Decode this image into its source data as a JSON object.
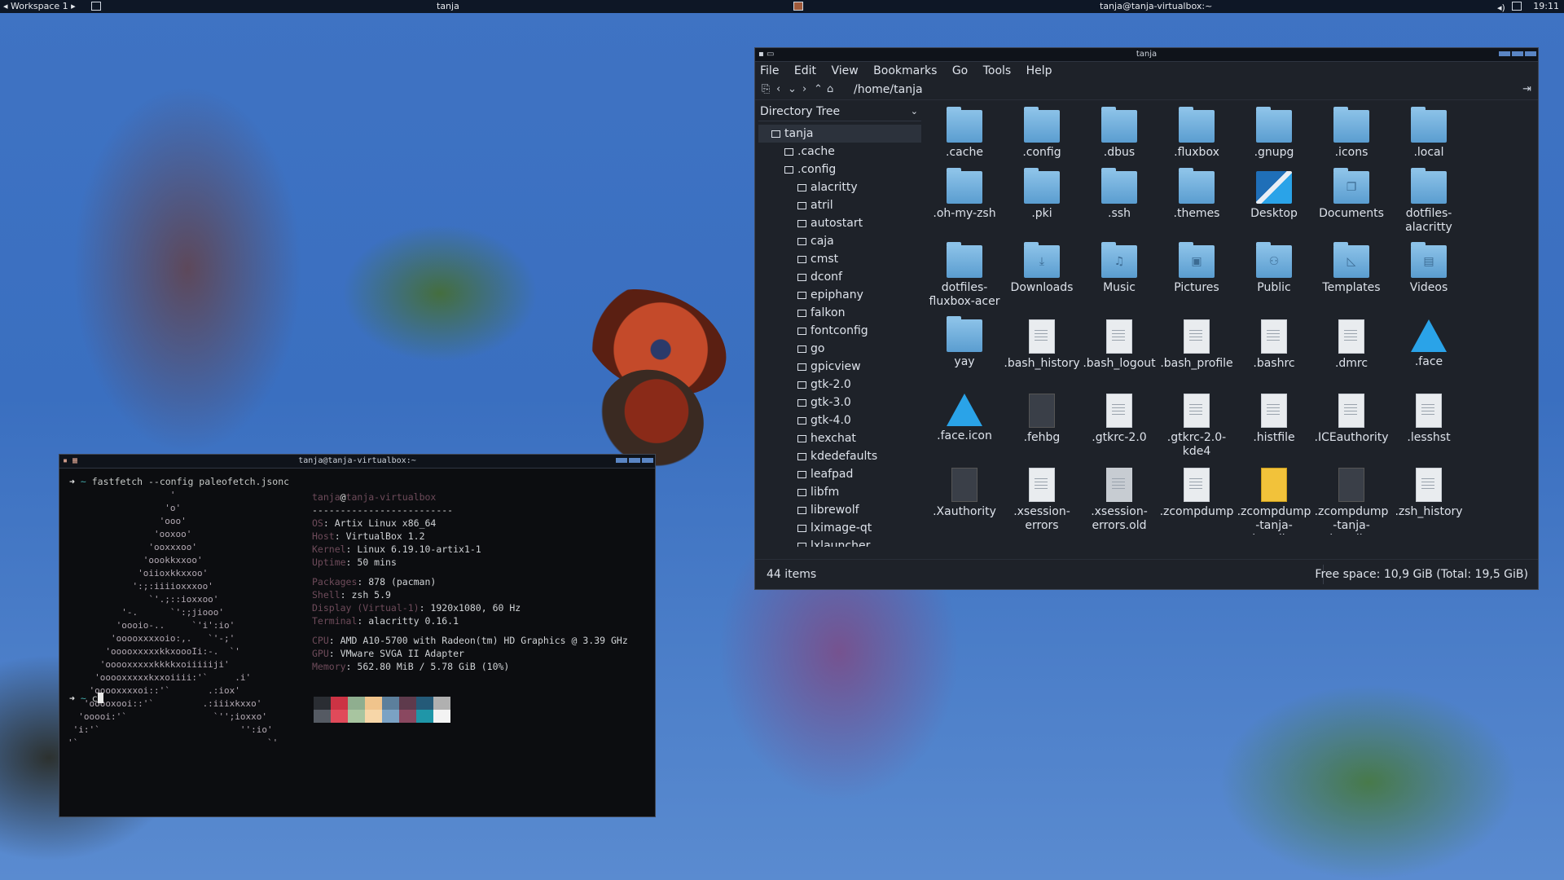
{
  "panel": {
    "workspace": "Workspace 1",
    "active_title": "tanja",
    "hostname": "tanja@tanja-virtualbox:~",
    "clock": "19:11"
  },
  "file_manager": {
    "title": "tanja",
    "menu": [
      "File",
      "Edit",
      "View",
      "Bookmarks",
      "Go",
      "Tools",
      "Help"
    ],
    "path": "/home/tanja",
    "sidebar_header": "Directory Tree",
    "tree": [
      {
        "label": "tanja",
        "level": 0,
        "selected": true
      },
      {
        "label": ".cache",
        "level": 1
      },
      {
        "label": ".config",
        "level": 1
      },
      {
        "label": "alacritty",
        "level": 2
      },
      {
        "label": "atril",
        "level": 2
      },
      {
        "label": "autostart",
        "level": 2
      },
      {
        "label": "caja",
        "level": 2
      },
      {
        "label": "cmst",
        "level": 2
      },
      {
        "label": "dconf",
        "level": 2
      },
      {
        "label": "epiphany",
        "level": 2
      },
      {
        "label": "falkon",
        "level": 2
      },
      {
        "label": "fontconfig",
        "level": 2
      },
      {
        "label": "go",
        "level": 2
      },
      {
        "label": "gpicview",
        "level": 2
      },
      {
        "label": "gtk-2.0",
        "level": 2
      },
      {
        "label": "gtk-3.0",
        "level": 2
      },
      {
        "label": "gtk-4.0",
        "level": 2
      },
      {
        "label": "hexchat",
        "level": 2
      },
      {
        "label": "kdedefaults",
        "level": 2
      },
      {
        "label": "leafpad",
        "level": 2
      },
      {
        "label": "libfm",
        "level": 2
      },
      {
        "label": "librewolf",
        "level": 2
      },
      {
        "label": "lximage-qt",
        "level": 2
      },
      {
        "label": "lxlauncher",
        "level": 2
      }
    ],
    "items": [
      {
        "label": ".cache",
        "kind": "folder"
      },
      {
        "label": ".config",
        "kind": "folder"
      },
      {
        "label": ".dbus",
        "kind": "folder"
      },
      {
        "label": ".fluxbox",
        "kind": "folder"
      },
      {
        "label": ".gnupg",
        "kind": "folder"
      },
      {
        "label": ".icons",
        "kind": "folder"
      },
      {
        "label": ".local",
        "kind": "folder"
      },
      {
        "label": ".oh-my-zsh",
        "kind": "folder"
      },
      {
        "label": ".pki",
        "kind": "folder"
      },
      {
        "label": ".ssh",
        "kind": "folder"
      },
      {
        "label": ".themes",
        "kind": "folder"
      },
      {
        "label": "Desktop",
        "kind": "desktop"
      },
      {
        "label": "Documents",
        "kind": "folder",
        "emblem": "❐"
      },
      {
        "label": "dotfiles-alacritty",
        "kind": "folder"
      },
      {
        "label": "dotfiles-fluxbox-acer",
        "kind": "folder"
      },
      {
        "label": "Downloads",
        "kind": "folder",
        "emblem": "⤓"
      },
      {
        "label": "Music",
        "kind": "folder",
        "emblem": "♫"
      },
      {
        "label": "Pictures",
        "kind": "folder",
        "emblem": "▣"
      },
      {
        "label": "Public",
        "kind": "folder",
        "emblem": "⚇"
      },
      {
        "label": "Templates",
        "kind": "folder",
        "emblem": "◺"
      },
      {
        "label": "Videos",
        "kind": "folder",
        "emblem": "▤"
      },
      {
        "label": "yay",
        "kind": "folder"
      },
      {
        "label": ".bash_history",
        "kind": "doc"
      },
      {
        "label": ".bash_logout",
        "kind": "doc"
      },
      {
        "label": ".bash_profile",
        "kind": "doc"
      },
      {
        "label": ".bashrc",
        "kind": "doc"
      },
      {
        "label": ".dmrc",
        "kind": "doc"
      },
      {
        "label": ".face",
        "kind": "image"
      },
      {
        "label": ".face.icon",
        "kind": "image"
      },
      {
        "label": ".fehbg",
        "kind": "script"
      },
      {
        "label": ".gtkrc-2.0",
        "kind": "doc"
      },
      {
        "label": ".gtkrc-2.0-kde4",
        "kind": "doc"
      },
      {
        "label": ".histfile",
        "kind": "doc"
      },
      {
        "label": ".ICEauthority",
        "kind": "doc"
      },
      {
        "label": ".lesshst",
        "kind": "doc"
      },
      {
        "label": ".Xauthority",
        "kind": "binary"
      },
      {
        "label": ".xsession-errors",
        "kind": "doc"
      },
      {
        "label": ".xsession-errors.old",
        "kind": "backup"
      },
      {
        "label": ".zcompdump",
        "kind": "doc"
      },
      {
        "label": ".zcompdump-tanja-virtualbox",
        "kind": "zip"
      },
      {
        "label": ".zcompdump-tanja-virtualbox",
        "kind": "binary"
      },
      {
        "label": ".zsh_history",
        "kind": "doc"
      }
    ],
    "status_count": "44 items",
    "status_free": "Free space: 10,9 GiB (Total: 19,5 GiB)"
  },
  "terminal": {
    "title": "tanja@tanja-virtualbox:~",
    "prompt_symbol": "➜",
    "prompt_dir": "~",
    "command": "fastfetch --config paleofetch.jsonc",
    "second_input": "c",
    "ascii_logo": [
      "                   '",
      "                  'o'",
      "                 'ooo'",
      "                'ooxoo'",
      "               'ooxxxoo'",
      "              'oookkxxoo'",
      "             'oiioxkkxxoo'",
      "            ':;:iiiioxxxoo'",
      "               `'.;::ioxxoo'",
      "          '-.      `':;jiooo'",
      "         'oooio-..     `'i':io'",
      "        'ooooxxxxoio:,.   `'-;'",
      "       'ooooxxxxxkkxoooIi:-.  `'",
      "      'ooooxxxxxkkkkxoiiiiiji'",
      "     'ooooxxxxxkxxoiiii:'`     .i'",
      "    'ooooxxxxoi::'`       .:iox'",
      "   'ooooxooi::'`         .:iiixkxxo'",
      "  'ooooi:'`                `'';ioxxo'",
      " 'i:'`                          '':io'",
      "'`                                   `'"
    ],
    "user": "tanja",
    "at": "@",
    "host": "tanja-virtualbox",
    "separator": "-------------------------",
    "info": [
      {
        "key": "OS",
        "value": "Artix Linux x86_64"
      },
      {
        "key": "Host",
        "value": "VirtualBox 1.2"
      },
      {
        "key": "Kernel",
        "value": "Linux 6.19.10-artix1-1"
      },
      {
        "key": "Uptime",
        "value": "50 mins"
      },
      {
        "key": "",
        "value": ""
      },
      {
        "key": "Packages",
        "value": "878 (pacman)"
      },
      {
        "key": "Shell",
        "value": "zsh 5.9"
      },
      {
        "key": "Display (Virtual-1)",
        "value": "1920x1080, 60 Hz"
      },
      {
        "key": "Terminal",
        "value": "alacritty 0.16.1"
      },
      {
        "key": "",
        "value": ""
      },
      {
        "key": "CPU",
        "value": "AMD A10-5700 with Radeon(tm) HD Graphics @ 3.39 GHz"
      },
      {
        "key": "GPU",
        "value": "VMware SVGA II Adapter"
      },
      {
        "key": "Memory",
        "value": "562.80 MiB / 5.78 GiB (10%)"
      }
    ],
    "palette_top": [
      "#2a2d33",
      "#cc3344",
      "#8fae8f",
      "#f0c48c",
      "#5c7f9c",
      "#5e3a4c",
      "#245a78",
      "#b0b0b0"
    ],
    "palette_bottom": [
      "#555a63",
      "#e04a5a",
      "#a8c5a0",
      "#f7d6a8",
      "#7ba2c4",
      "#8a4860",
      "#1f96a8",
      "#f3f3f3"
    ]
  },
  "colors": {
    "accent": "#5a85c4",
    "folder": "#6aaee0",
    "prompt": "#7fbf7f"
  }
}
